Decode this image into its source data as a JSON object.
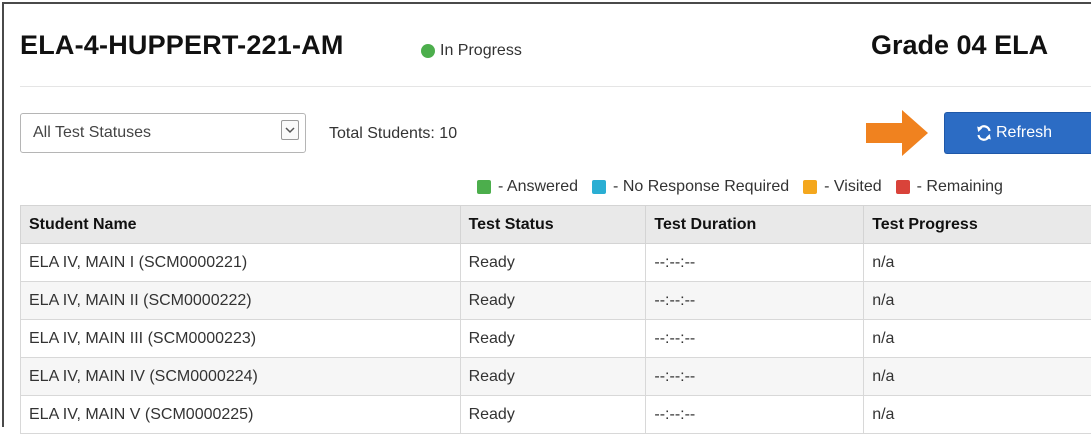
{
  "header": {
    "session_name": "ELA-4-HUPPERT-221-AM",
    "status": "In Progress",
    "status_color": "#4cae4c",
    "grade": "Grade 04 ELA"
  },
  "toolbar": {
    "filter_selected": "All Test Statuses",
    "total_students": "Total Students: 10",
    "refresh_label": "Refresh",
    "accent_color": "#2c6cc4",
    "arrow_color": "#f0821f"
  },
  "legend": [
    {
      "label": "- Answered",
      "color": "#4cae4c"
    },
    {
      "label": "- No Response Required",
      "color": "#2aaed3"
    },
    {
      "label": "- Visited",
      "color": "#f4a71d"
    },
    {
      "label": "- Remaining",
      "color": "#d9433a"
    }
  ],
  "table": {
    "columns": [
      "Student Name",
      "Test Status",
      "Test Duration",
      "Test Progress"
    ],
    "rows": [
      [
        "ELA IV, MAIN I (SCM0000221)",
        "Ready",
        "--:--:--",
        "n/a"
      ],
      [
        "ELA IV, MAIN II (SCM0000222)",
        "Ready",
        "--:--:--",
        "n/a"
      ],
      [
        "ELA IV, MAIN III (SCM0000223)",
        "Ready",
        "--:--:--",
        "n/a"
      ],
      [
        "ELA IV, MAIN IV (SCM0000224)",
        "Ready",
        "--:--:--",
        "n/a"
      ],
      [
        "ELA IV, MAIN V (SCM0000225)",
        "Ready",
        "--:--:--",
        "n/a"
      ]
    ]
  }
}
